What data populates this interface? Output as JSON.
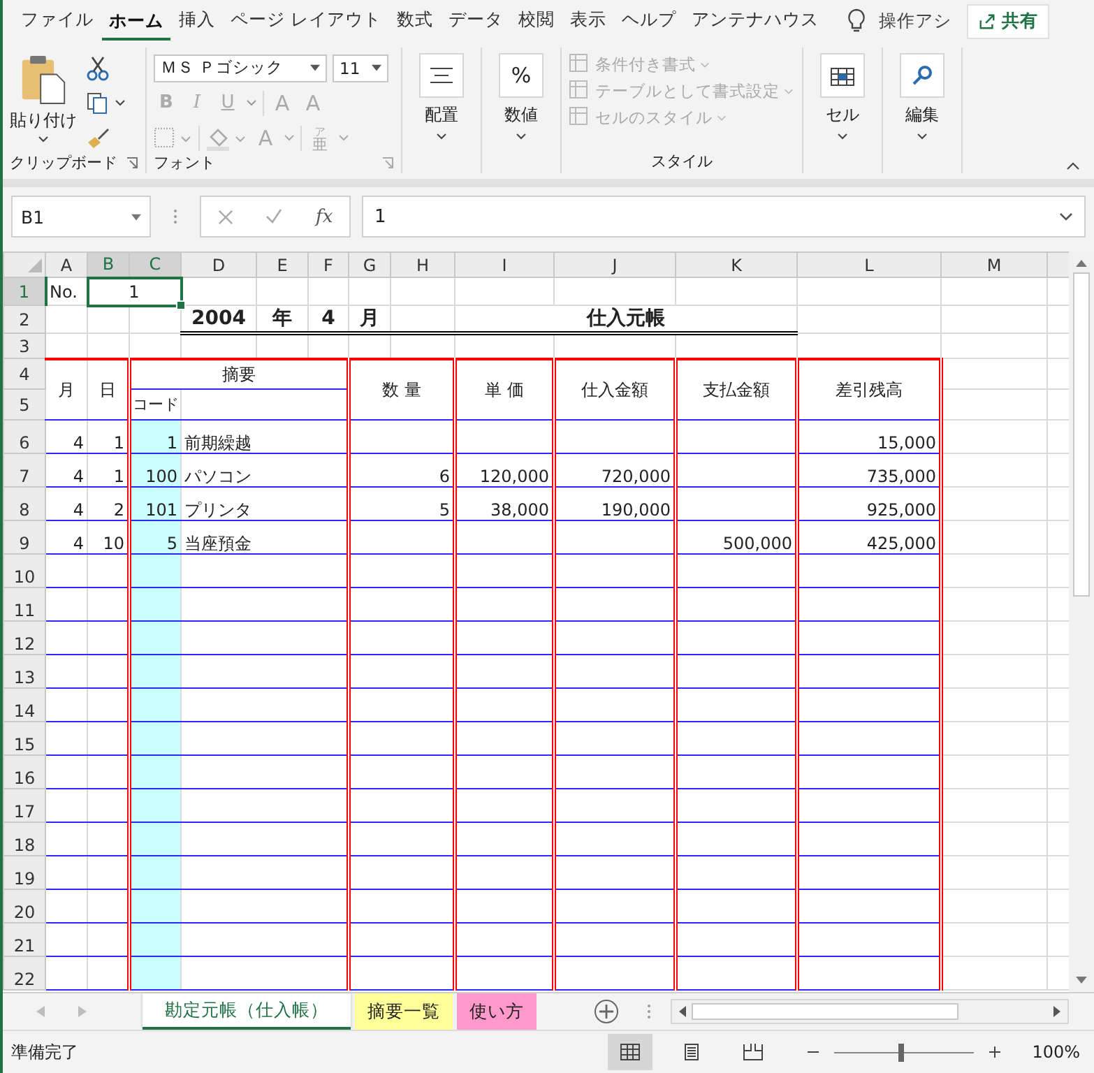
{
  "menu_tabs": [
    {
      "label": "ファイル",
      "selected": false
    },
    {
      "label": "ホーム",
      "selected": true
    },
    {
      "label": "挿入",
      "selected": false
    },
    {
      "label": "ページ レイアウト",
      "selected": false
    },
    {
      "label": "数式",
      "selected": false
    },
    {
      "label": "データ",
      "selected": false
    },
    {
      "label": "校閲",
      "selected": false
    },
    {
      "label": "表示",
      "selected": false
    },
    {
      "label": "ヘルプ",
      "selected": false
    },
    {
      "label": "アンテナハウス",
      "selected": false
    }
  ],
  "tell_me": "操作アシ",
  "share_button": "共有",
  "ribbon": {
    "clipboard": {
      "paste": "貼り付け",
      "label": "クリップボード"
    },
    "font": {
      "name": "ＭＳ Ｐゴシック",
      "size": "11",
      "bold": "B",
      "italic": "I",
      "underline": "U",
      "grow": "A",
      "shrink": "A",
      "font_color": "A",
      "furigana_ruby": "ア",
      "furigana_base": "亜",
      "label": "フォント"
    },
    "alignment": "配置",
    "number": "数値",
    "number_icon": "%",
    "styles": {
      "items": [
        {
          "label": "条件付き書式",
          "disabled": true
        },
        {
          "label": "テーブルとして書式設定",
          "disabled": true
        },
        {
          "label": "セルのスタイル",
          "disabled": true
        }
      ],
      "label": "スタイル"
    },
    "cells": "セル",
    "editing": "編集"
  },
  "formula_bar": {
    "name_box": "B1",
    "function_button": "fx",
    "formula": "1"
  },
  "sheet": {
    "columns": [
      {
        "label": "A",
        "selected": false
      },
      {
        "label": "B",
        "selected": true
      },
      {
        "label": "C",
        "selected": true
      },
      {
        "label": "D",
        "selected": false
      },
      {
        "label": "E",
        "selected": false
      },
      {
        "label": "F",
        "selected": false
      },
      {
        "label": "G",
        "selected": false
      },
      {
        "label": "H",
        "selected": false
      },
      {
        "label": "I",
        "selected": false
      },
      {
        "label": "J",
        "selected": false
      },
      {
        "label": "K",
        "selected": false
      },
      {
        "label": "L",
        "selected": false
      },
      {
        "label": "M",
        "selected": false
      }
    ],
    "rows": [
      {
        "label": "1",
        "selected": true
      },
      {
        "label": "2",
        "selected": false
      },
      {
        "label": "3",
        "selected": false
      },
      {
        "label": "4",
        "selected": false
      },
      {
        "label": "5",
        "selected": false
      },
      {
        "label": "6",
        "selected": false
      },
      {
        "label": "7",
        "selected": false
      },
      {
        "label": "8",
        "selected": false
      },
      {
        "label": "9",
        "selected": false
      },
      {
        "label": "10",
        "selected": false
      },
      {
        "label": "11",
        "selected": false
      },
      {
        "label": "12",
        "selected": false
      },
      {
        "label": "13",
        "selected": false
      },
      {
        "label": "14",
        "selected": false
      },
      {
        "label": "15",
        "selected": false
      },
      {
        "label": "16",
        "selected": false
      },
      {
        "label": "17",
        "selected": false
      },
      {
        "label": "18",
        "selected": false
      },
      {
        "label": "19",
        "selected": false
      },
      {
        "label": "20",
        "selected": false
      },
      {
        "label": "21",
        "selected": false
      },
      {
        "label": "22",
        "selected": false
      }
    ],
    "no_label": "No.",
    "no_value": "1",
    "year": "2004",
    "year_unit": "年",
    "month": "4",
    "month_unit": "月",
    "title": "仕入元帳",
    "headers": {
      "month": "月",
      "day": "日",
      "summary": "摘要",
      "code": "コード",
      "quantity": "数 量",
      "unit_price": "単 価",
      "purchase": "仕入金額",
      "payment": "支払金額",
      "balance": "差引残高"
    },
    "entries": [
      {
        "month": "4",
        "day": "1",
        "code": "1",
        "description": "前期繰越",
        "balance": "15,000"
      },
      {
        "month": "4",
        "day": "1",
        "code": "100",
        "description": "パソコン",
        "quantity": "6",
        "unit_price": "120,000",
        "purchase": "720,000",
        "balance": "735,000"
      },
      {
        "month": "4",
        "day": "2",
        "code": "101",
        "description": "プリンタ",
        "quantity": "5",
        "unit_price": "38,000",
        "purchase": "190,000",
        "balance": "925,000"
      },
      {
        "month": "4",
        "day": "10",
        "code": "5",
        "description": "当座預金",
        "payment": "500,000",
        "balance": "425,000"
      }
    ]
  },
  "sheet_tabs": [
    {
      "label": "勘定元帳（仕入帳）",
      "selected": true,
      "color": "#ffffff"
    },
    {
      "label": "摘要一覧",
      "selected": false,
      "color": "#ffff99"
    },
    {
      "label": "使い方",
      "selected": false,
      "color": "#ff99cc"
    }
  ],
  "status_bar": {
    "status": "準備完了",
    "views": [
      {
        "kind": "normal",
        "selected": true
      },
      {
        "kind": "page_layout",
        "selected": false
      },
      {
        "kind": "page_break",
        "selected": false
      }
    ],
    "zoom_slider": {
      "level": 0.48
    },
    "zoom": "100%"
  }
}
